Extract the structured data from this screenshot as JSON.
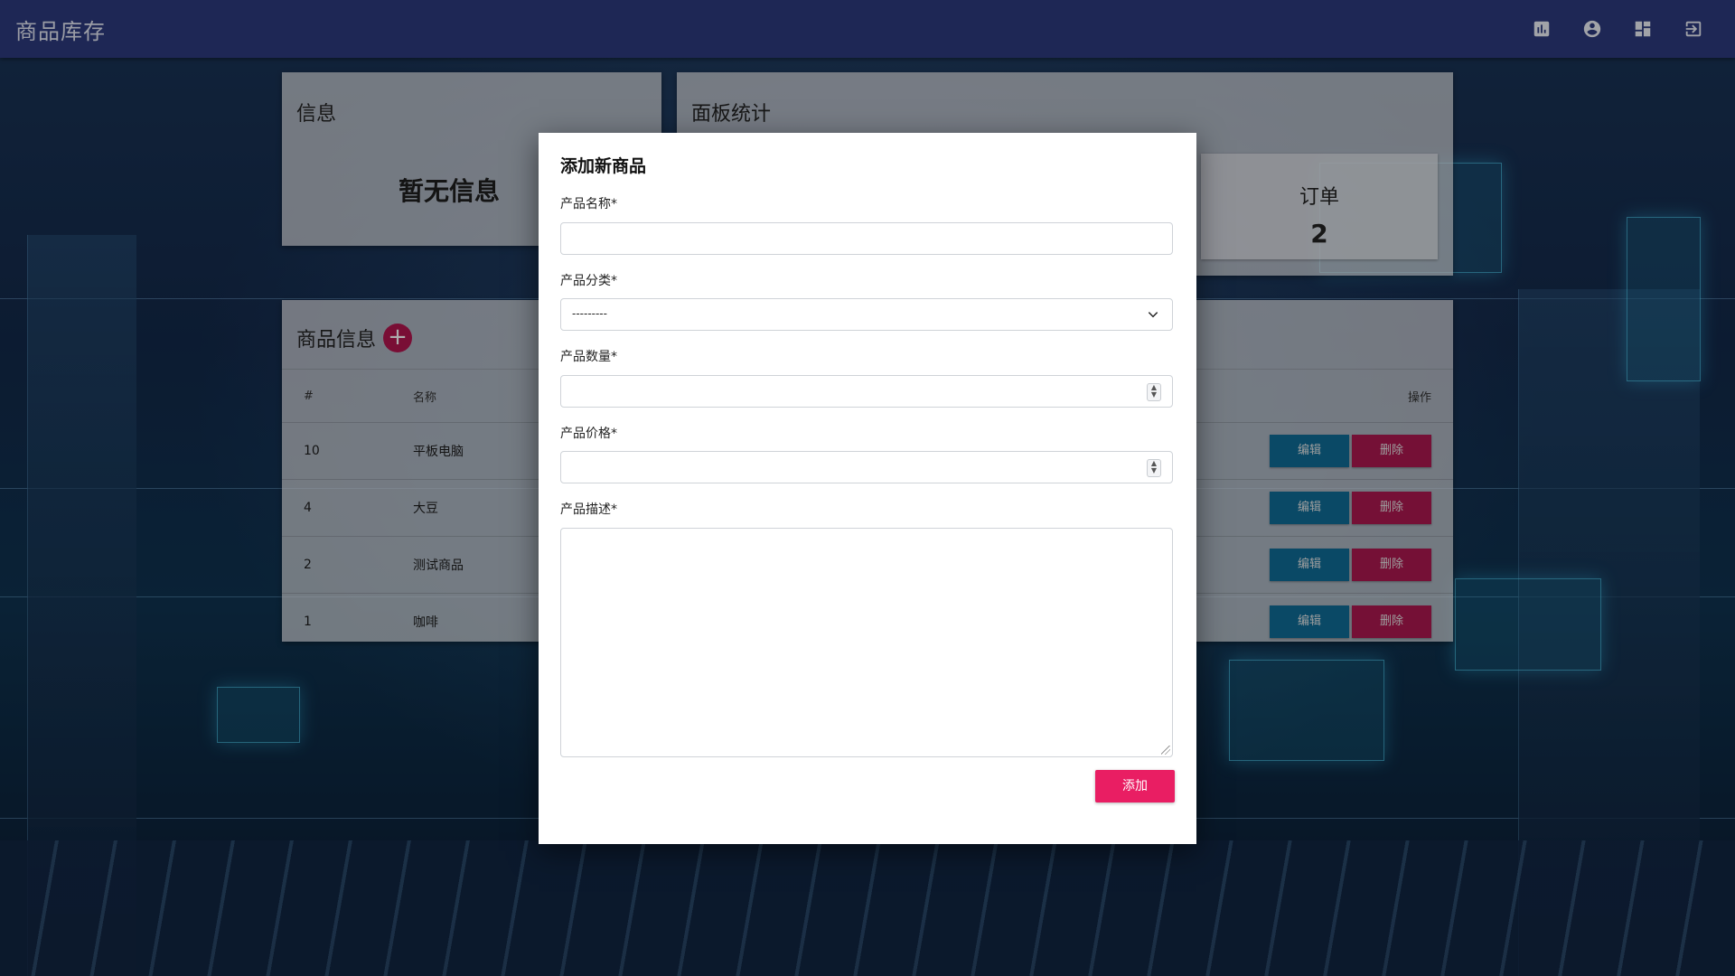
{
  "app": {
    "title": "商品库存"
  },
  "topbar": {
    "icons": [
      {
        "name": "bar-chart-icon"
      },
      {
        "name": "account-circle-icon"
      },
      {
        "name": "dashboard-icon"
      },
      {
        "name": "logout-icon"
      }
    ]
  },
  "info_card": {
    "title": "信息",
    "empty_text": "暂无信息"
  },
  "stats_card": {
    "title": "面板统计",
    "order_label": "订单",
    "order_value": "2"
  },
  "products": {
    "title": "商品信息",
    "add_icon": "+",
    "columns": {
      "id": "#",
      "name": "名称",
      "actions": "操作"
    },
    "edit_label": "编辑",
    "delete_label": "删除",
    "rows": [
      {
        "id": "10",
        "name": "平板电脑"
      },
      {
        "id": "4",
        "name": "大豆"
      },
      {
        "id": "2",
        "name": "测试商品"
      },
      {
        "id": "1",
        "name": "咖啡"
      }
    ]
  },
  "modal": {
    "title": "添加新商品",
    "name_label": "产品名称*",
    "name_value": "",
    "category_label": "产品分类*",
    "category_value": "---------",
    "quantity_label": "产品数量*",
    "quantity_value": "",
    "price_label": "产品价格*",
    "price_value": "",
    "description_label": "产品描述*",
    "description_value": "",
    "submit_label": "添加"
  },
  "colors": {
    "topbar": "#2d3a7e",
    "accent_pink": "#e91e63",
    "edit_blue": "#0f6c97",
    "delete_red": "#ad1950"
  }
}
